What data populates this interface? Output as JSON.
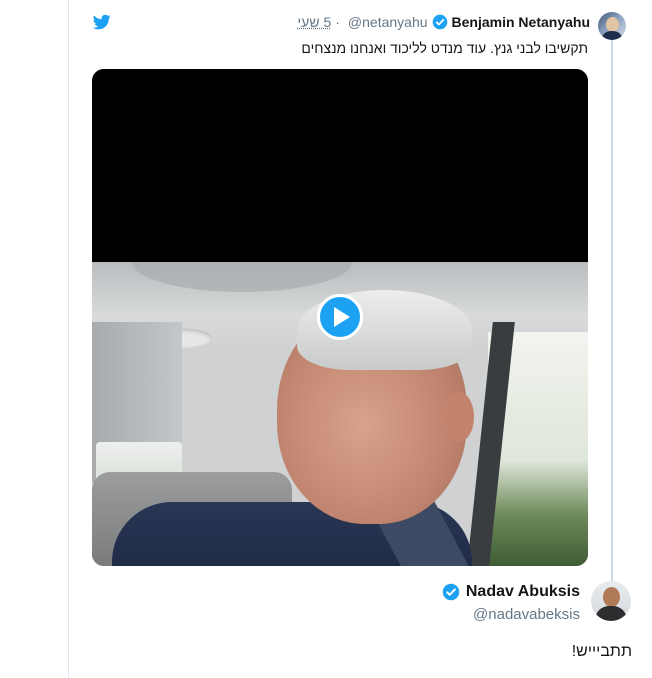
{
  "quoted_tweet": {
    "author_name": "Benjamin Netanyahu",
    "handle": "@netanyahu",
    "separator": "·",
    "time": "5 שעי",
    "text": "תקשיבו לבני גנץ. עוד מנדט לליכוד ואנחנו מנצחים",
    "verified_icon": "verified-badge-icon",
    "platform_icon": "twitter-bird-icon"
  },
  "video": {
    "play_icon": "play-icon",
    "thumbnail": "man-speaking-in-car"
  },
  "reply": {
    "author_name": "Nadav Abuksis",
    "handle": "@nadavabeksis",
    "text": "תתביייש!",
    "verified_icon": "verified-badge-icon"
  },
  "colors": {
    "twitter_blue": "#1da1f2",
    "text_primary": "#14171a",
    "text_secondary": "#657786",
    "border": "#e1e8ed",
    "thread_line": "#ccd6dd"
  }
}
